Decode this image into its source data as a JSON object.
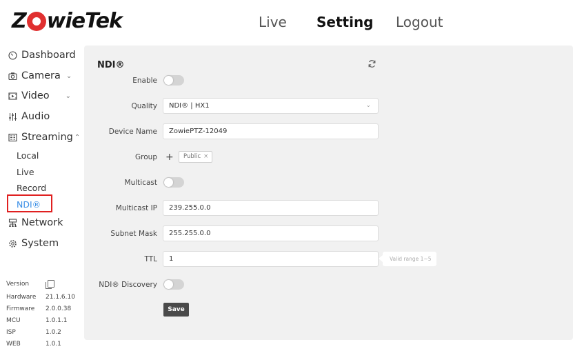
{
  "brand": {
    "logo_left": "Z",
    "logo_mid": "wieTek"
  },
  "nav": {
    "live": "Live",
    "setting": "Setting",
    "logout": "Logout"
  },
  "sidebar": {
    "dashboard": "Dashboard",
    "camera": "Camera",
    "video": "Video",
    "audio": "Audio",
    "streaming": "Streaming",
    "sub": {
      "local": "Local",
      "live": "Live",
      "record": "Record",
      "ndi": "NDI®"
    },
    "network": "Network",
    "system": "System"
  },
  "version": {
    "label": "Version",
    "rows": [
      {
        "k": "Hardware",
        "v": "21.1.6.10"
      },
      {
        "k": "Firmware",
        "v": "2.0.0.38"
      },
      {
        "k": "MCU",
        "v": "1.0.1.1"
      },
      {
        "k": "ISP",
        "v": "1.0.2"
      },
      {
        "k": "WEB",
        "v": "1.0.1"
      }
    ]
  },
  "panel": {
    "title": "NDI®",
    "enable_label": "Enable",
    "quality_label": "Quality",
    "quality_value": "NDI® | HX1",
    "device_name_label": "Device Name",
    "device_name_value": "ZowiePTZ-12049",
    "group_label": "Group",
    "group_add": "+",
    "group_tag": "Public",
    "group_tag_remove": "×",
    "multicast_label": "Multicast",
    "multicast_ip_label": "Multicast IP",
    "multicast_ip_value": "239.255.0.0",
    "subnet_mask_label": "Subnet Mask",
    "subnet_mask_value": "255.255.0.0",
    "ttl_label": "TTL",
    "ttl_value": "1",
    "ttl_tip": "Valid range 1~5",
    "discovery_label": "NDI® Discovery",
    "save_label": "Save"
  },
  "icons": {
    "dashboard": "gauge-icon",
    "camera": "camera-icon",
    "video": "video-icon",
    "audio": "audio-icon",
    "streaming": "streaming-icon",
    "network": "network-icon",
    "system": "gear-icon",
    "refresh": "refresh-icon",
    "copy": "copy-icon"
  },
  "colors": {
    "accent": "#3a8ee6",
    "highlight_box": "#e02020",
    "logo_red": "#e03030",
    "save_button": "#4a4a4a"
  }
}
